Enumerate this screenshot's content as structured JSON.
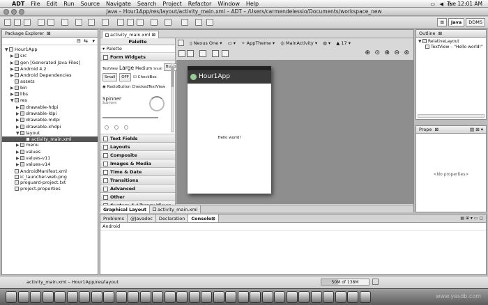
{
  "menubar": {
    "apple": "",
    "app": "ADT",
    "items": [
      "File",
      "Edit",
      "Run",
      "Source",
      "Navigate",
      "Search",
      "Project",
      "Refactor",
      "Window",
      "Help"
    ],
    "clock": "Tue 12:01 AM"
  },
  "window": {
    "title": "Java – Hour1App/res/layout/activity_main.xml – ADT – /Users/carmendelessio/Documents/workspace_new"
  },
  "perspectives": {
    "java": "Java",
    "ddms": "DDMS"
  },
  "package_explorer": {
    "title": "Package Explorer",
    "tree": [
      {
        "label": "Hour1App",
        "level": 0,
        "arrow": "▼",
        "type": "project"
      },
      {
        "label": "src",
        "level": 1,
        "arrow": "▶",
        "type": "folder"
      },
      {
        "label": "gen [Generated Java Files]",
        "level": 1,
        "arrow": "▶",
        "type": "folder"
      },
      {
        "label": "Android 4.2",
        "level": 1,
        "arrow": "▶",
        "type": "lib"
      },
      {
        "label": "Android Dependencies",
        "level": 1,
        "arrow": "▶",
        "type": "lib"
      },
      {
        "label": "assets",
        "level": 1,
        "arrow": "",
        "type": "folder"
      },
      {
        "label": "bin",
        "level": 1,
        "arrow": "▶",
        "type": "folder"
      },
      {
        "label": "libs",
        "level": 1,
        "arrow": "▶",
        "type": "folder"
      },
      {
        "label": "res",
        "level": 1,
        "arrow": "▼",
        "type": "folder"
      },
      {
        "label": "drawable-hdpi",
        "level": 2,
        "arrow": "▶",
        "type": "folder"
      },
      {
        "label": "drawable-ldpi",
        "level": 2,
        "arrow": "▶",
        "type": "folder"
      },
      {
        "label": "drawable-mdpi",
        "level": 2,
        "arrow": "▶",
        "type": "folder"
      },
      {
        "label": "drawable-xhdpi",
        "level": 2,
        "arrow": "▶",
        "type": "folder"
      },
      {
        "label": "layout",
        "level": 2,
        "arrow": "▼",
        "type": "folder"
      },
      {
        "label": "activity_main.xml",
        "level": 3,
        "arrow": "",
        "type": "file",
        "selected": true
      },
      {
        "label": "menu",
        "level": 2,
        "arrow": "▶",
        "type": "folder"
      },
      {
        "label": "values",
        "level": 2,
        "arrow": "▶",
        "type": "folder"
      },
      {
        "label": "values-v11",
        "level": 2,
        "arrow": "▶",
        "type": "folder"
      },
      {
        "label": "values-v14",
        "level": 2,
        "arrow": "▶",
        "type": "folder"
      },
      {
        "label": "AndroidManifest.xml",
        "level": 1,
        "arrow": "",
        "type": "file"
      },
      {
        "label": "ic_launcher-web.png",
        "level": 1,
        "arrow": "",
        "type": "file"
      },
      {
        "label": "proguard-project.txt",
        "level": 1,
        "arrow": "",
        "type": "file"
      },
      {
        "label": "project.properties",
        "level": 1,
        "arrow": "",
        "type": "file"
      }
    ]
  },
  "editor": {
    "tab": "activity_main.xml",
    "palette_label": "Palette",
    "palette_dropdown": "Palette",
    "form_widgets": "Form Widgets",
    "textview_sizes": [
      "TextView",
      "Large",
      "Medium",
      "Small"
    ],
    "button_label": "Button",
    "small_label": "Small",
    "off_label": "OFF",
    "checkbox_label": "CheckBox",
    "radio_label": "RadioButton",
    "checked_tv_label": "CheckedTextView",
    "spinner_label": "Spinner",
    "spinner_sub": "Sub Item",
    "sections": [
      "Text Fields",
      "Layouts",
      "Composite",
      "Images & Media",
      "Time & Date",
      "Transitions",
      "Advanced",
      "Other",
      "Custom & Library Views"
    ],
    "device": "Nexus One",
    "theme": "AppTheme",
    "activity": "MainActivity",
    "api": "17",
    "app_title": "Hour1App",
    "hello": "Hello world!",
    "bottom_tabs": [
      "Graphical Layout",
      "activity_main.xml"
    ]
  },
  "outline": {
    "title": "Outline",
    "root": "RelativeLayout",
    "child": "TextView – \"Hello world!\""
  },
  "properties": {
    "title": "Prope",
    "empty": "<No properties>"
  },
  "console": {
    "tabs": [
      "Problems",
      "Javadoc",
      "Declaration",
      "Console"
    ],
    "content": "Android"
  },
  "status": {
    "path": "activity_main.xml – Hour1App/res/layout",
    "memory": "50M of 138M"
  },
  "watermark": "www.yesdb.com"
}
